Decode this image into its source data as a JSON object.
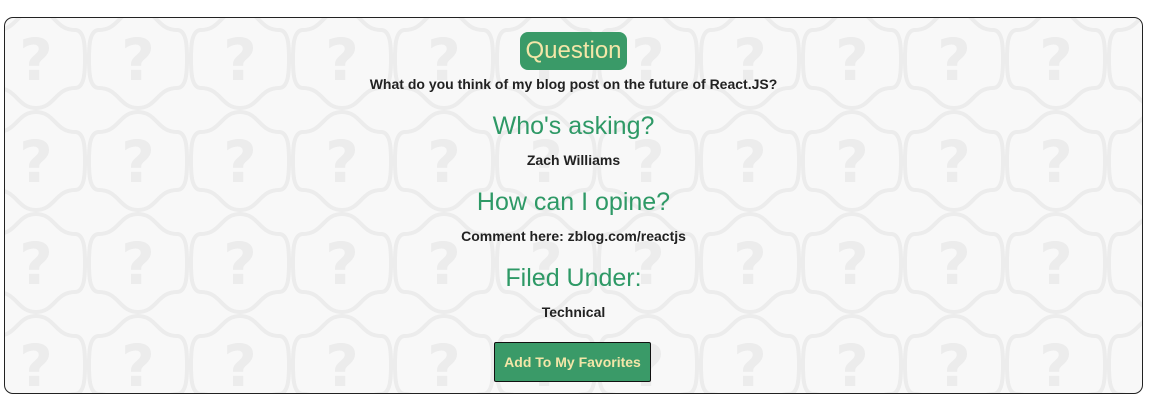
{
  "card": {
    "badge_label": "Question",
    "question": "What do you think of my blog post on the future of React.JS?",
    "asker_heading": "Who's asking?",
    "asker_name": "Zach Williams",
    "opine_heading": "How can I opine?",
    "opine_text": "Comment here: zblog.com/reactjs",
    "filed_heading": "Filed Under:",
    "category": "Technical",
    "favorite_button_label": "Add To My Favorites"
  },
  "colors": {
    "accent_green": "#3a9a68",
    "heading_green": "#2e9966",
    "badge_text": "#f3e6a8"
  },
  "background_icon": "question-mark-pattern-icon"
}
